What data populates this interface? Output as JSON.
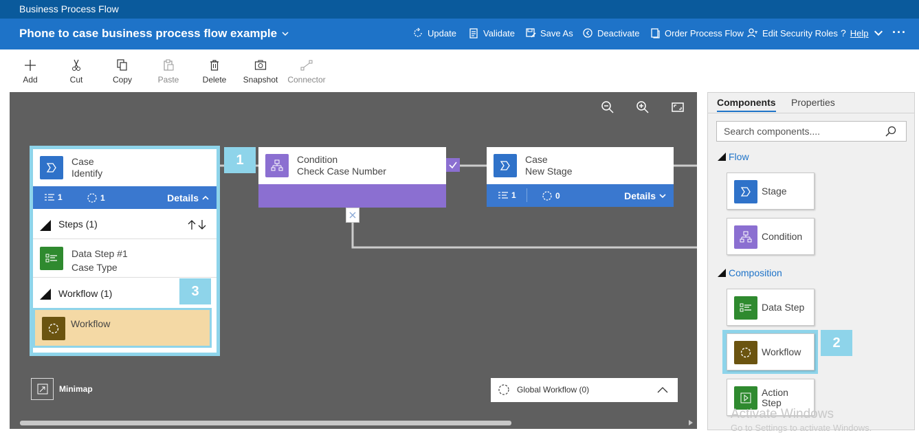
{
  "app_title": "Business Process Flow",
  "process_title": "Phone to case business process flow example",
  "commands": [
    {
      "label": "Update",
      "icon": "refresh-icon"
    },
    {
      "label": "Validate",
      "icon": "clipboard-check-icon"
    },
    {
      "label": "Save As",
      "icon": "save-as-icon"
    },
    {
      "label": "Deactivate",
      "icon": "deactivate-icon"
    },
    {
      "label": "Order Process Flow",
      "icon": "document-order-icon"
    },
    {
      "label": "Edit Security Roles",
      "icon": "security-roles-icon"
    },
    {
      "label": "Help",
      "icon": "help-icon"
    }
  ],
  "toolbar": [
    {
      "label": "Add",
      "icon": "plus-icon",
      "enabled": true
    },
    {
      "label": "Cut",
      "icon": "scissors-icon",
      "enabled": true
    },
    {
      "label": "Copy",
      "icon": "copy-icon",
      "enabled": true
    },
    {
      "label": "Paste",
      "icon": "paste-icon",
      "enabled": false
    },
    {
      "label": "Delete",
      "icon": "trash-icon",
      "enabled": true
    },
    {
      "label": "Snapshot",
      "icon": "camera-icon",
      "enabled": true
    },
    {
      "label": "Connector",
      "icon": "connector-icon",
      "enabled": false
    }
  ],
  "canvas": {
    "stage1": {
      "type": "Case",
      "name": "Identify",
      "steps_count": "1",
      "workflow_count": "1",
      "details": "Details",
      "steps_header": "Steps (1)",
      "step": {
        "name": "Data Step #1",
        "field": "Case Type"
      },
      "workflow_header": "Workflow (1)",
      "workflow_item": "Workflow"
    },
    "condition": {
      "type": "Condition",
      "name": "Check Case Number"
    },
    "stage2": {
      "type": "Case",
      "name": "New Stage",
      "steps_count": "1",
      "workflow_count": "0",
      "details": "Details"
    },
    "minimap": "Minimap",
    "global_workflow": "Global Workflow (0)"
  },
  "callouts": [
    "1",
    "2",
    "3"
  ],
  "panel": {
    "tabs": [
      "Components",
      "Properties"
    ],
    "search_placeholder": "Search components....",
    "flow_section": "Flow",
    "flow_items": [
      "Stage",
      "Condition"
    ],
    "composition_section": "Composition",
    "composition_items": [
      "Data Step",
      "Workflow",
      "Action Step"
    ]
  },
  "watermark": {
    "line1": "Activate Windows",
    "line2": "Go to Settings to activate Windows."
  },
  "colors": {
    "app_bar": "#0a5a9c",
    "command_bar": "#1e73c8",
    "stage_blue": "#2f72c9",
    "condition_purple": "#8b6fd1",
    "data_step_green": "#2f8a2f",
    "workflow_brown": "#6b5410",
    "callout": "#8ed4ea",
    "workflow_highlight": "#f4d9a5"
  }
}
